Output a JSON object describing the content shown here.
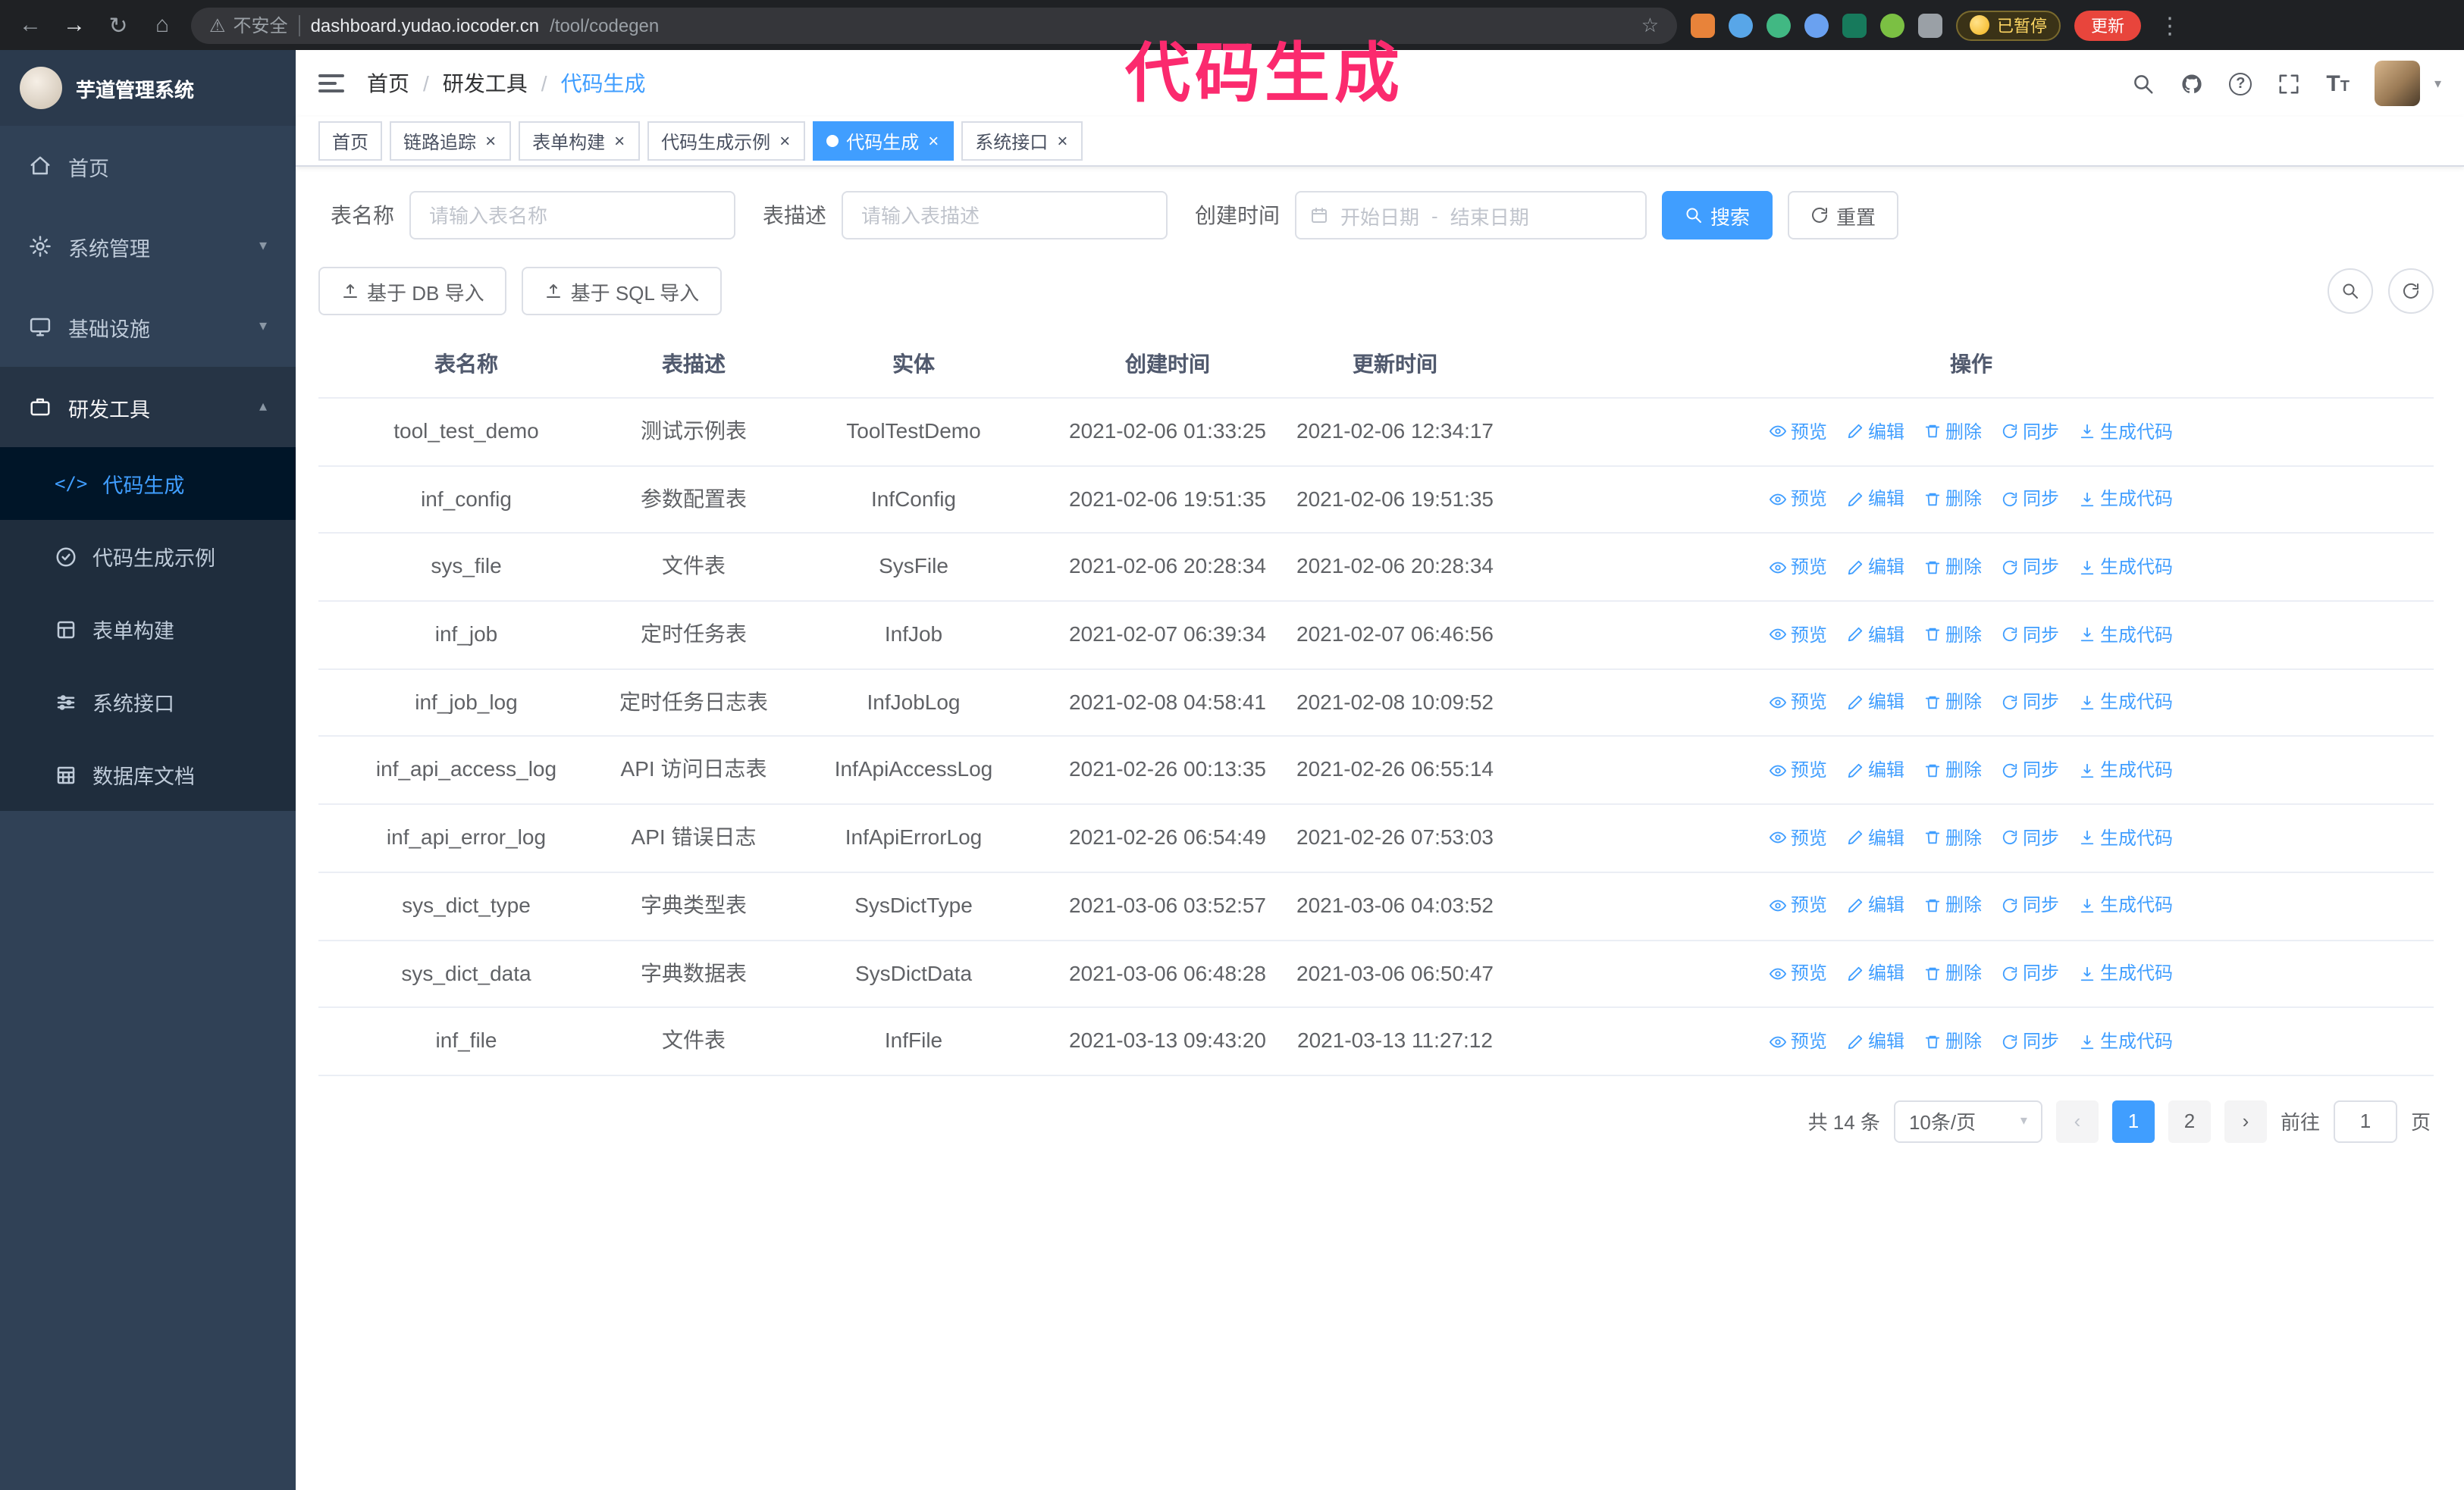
{
  "annotation": {
    "text": "代码生成",
    "color": "#fb2a6e"
  },
  "browser": {
    "security_label": "不安全",
    "url_host": "dashboard.yudao.iocoder.cn",
    "url_path": "/tool/codegen",
    "paused_badge": "已暂停",
    "update_button": "更新"
  },
  "icons": {
    "back": "←",
    "forward": "→",
    "reload": "↻",
    "home": "⌂",
    "warning": "⚠",
    "star": "☆",
    "kebab": "⋮",
    "close": "×",
    "caret_down": "▾",
    "caret_up": "▴",
    "separator": "/",
    "dash": "-",
    "prev": "‹",
    "next": "›",
    "question": "?",
    "code": "</>",
    "font_size": "T"
  },
  "sidebar": {
    "logo_title": "芋道管理系统",
    "items": [
      {
        "label": "首页"
      },
      {
        "label": "系统管理"
      },
      {
        "label": "基础设施"
      },
      {
        "label": "研发工具"
      }
    ],
    "subitems": [
      {
        "label": "代码生成"
      },
      {
        "label": "代码生成示例"
      },
      {
        "label": "表单构建"
      },
      {
        "label": "系统接口"
      },
      {
        "label": "数据库文档"
      }
    ]
  },
  "breadcrumb": [
    "首页",
    "研发工具",
    "代码生成"
  ],
  "tabs": [
    {
      "label": "首页"
    },
    {
      "label": "链路追踪"
    },
    {
      "label": "表单构建"
    },
    {
      "label": "代码生成示例"
    },
    {
      "label": "代码生成"
    },
    {
      "label": "系统接口"
    }
  ],
  "filters": {
    "table_name_label": "表名称",
    "table_name_placeholder": "请输入表名称",
    "table_desc_label": "表描述",
    "table_desc_placeholder": "请输入表描述",
    "create_time_label": "创建时间",
    "date_start_placeholder": "开始日期",
    "date_end_placeholder": "结束日期",
    "search_button": "搜索",
    "reset_button": "重置"
  },
  "toolbar": {
    "import_db": "基于 DB 导入",
    "import_sql": "基于 SQL 导入"
  },
  "table": {
    "columns": [
      "表名称",
      "表描述",
      "实体",
      "创建时间",
      "更新时间",
      "操作"
    ],
    "actions": [
      "预览",
      "编辑",
      "删除",
      "同步",
      "生成代码"
    ],
    "rows": [
      {
        "name": "tool_test_demo",
        "desc": "测试示例表",
        "entity": "ToolTestDemo",
        "created": "2021-02-06 01:33:25",
        "updated": "2021-02-06 12:34:17"
      },
      {
        "name": "inf_config",
        "desc": "参数配置表",
        "entity": "InfConfig",
        "created": "2021-02-06 19:51:35",
        "updated": "2021-02-06 19:51:35"
      },
      {
        "name": "sys_file",
        "desc": "文件表",
        "entity": "SysFile",
        "created": "2021-02-06 20:28:34",
        "updated": "2021-02-06 20:28:34"
      },
      {
        "name": "inf_job",
        "desc": "定时任务表",
        "entity": "InfJob",
        "created": "2021-02-07 06:39:34",
        "updated": "2021-02-07 06:46:56"
      },
      {
        "name": "inf_job_log",
        "desc": "定时任务日志表",
        "entity": "InfJobLog",
        "created": "2021-02-08 04:58:41",
        "updated": "2021-02-08 10:09:52"
      },
      {
        "name": "inf_api_access_log",
        "desc": "API 访问日志表",
        "entity": "InfApiAccessLog",
        "created": "2021-02-26 00:13:35",
        "updated": "2021-02-26 06:55:14"
      },
      {
        "name": "inf_api_error_log",
        "desc": "API 错误日志",
        "entity": "InfApiErrorLog",
        "created": "2021-02-26 06:54:49",
        "updated": "2021-02-26 07:53:03"
      },
      {
        "name": "sys_dict_type",
        "desc": "字典类型表",
        "entity": "SysDictType",
        "created": "2021-03-06 03:52:57",
        "updated": "2021-03-06 04:03:52"
      },
      {
        "name": "sys_dict_data",
        "desc": "字典数据表",
        "entity": "SysDictData",
        "created": "2021-03-06 06:48:28",
        "updated": "2021-03-06 06:50:47"
      },
      {
        "name": "inf_file",
        "desc": "文件表",
        "entity": "InfFile",
        "created": "2021-03-13 09:43:20",
        "updated": "2021-03-13 11:27:12"
      }
    ]
  },
  "pagination": {
    "total": "共 14 条",
    "page_size": "10条/页",
    "pages": [
      "1",
      "2"
    ],
    "goto_label": "前往",
    "goto_value": "1",
    "goto_suffix": "页"
  }
}
